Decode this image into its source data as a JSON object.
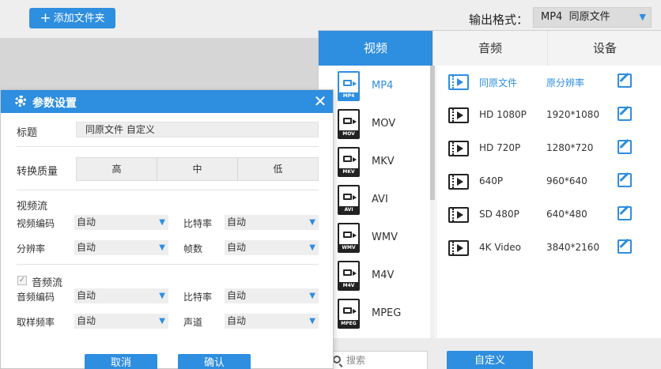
{
  "topbar": {
    "add_folder_label": "添加文件夹",
    "output_format_label": "输出格式：",
    "output_format_value": "MP4  同原文件"
  },
  "format_panel": {
    "tabs": [
      {
        "label": "视频",
        "active": true
      },
      {
        "label": "音频",
        "active": false
      },
      {
        "label": "设备",
        "active": false
      }
    ],
    "formats": [
      {
        "name": "MP4",
        "tag": "MP4",
        "selected": true
      },
      {
        "name": "MOV",
        "tag": "MOV",
        "selected": false
      },
      {
        "name": "MKV",
        "tag": "MKV",
        "selected": false
      },
      {
        "name": "AVI",
        "tag": "AVI",
        "selected": false
      },
      {
        "name": "WMV",
        "tag": "WMV",
        "selected": false
      },
      {
        "name": "M4V",
        "tag": "M4V",
        "selected": false
      },
      {
        "name": "MPEG",
        "tag": "MPEG",
        "selected": false
      }
    ],
    "presets": [
      {
        "name": "同原文件",
        "resolution": "原分辨率",
        "selected": true
      },
      {
        "name": "HD 1080P",
        "resolution": "1920*1080",
        "selected": false
      },
      {
        "name": "HD 720P",
        "resolution": "1280*720",
        "selected": false
      },
      {
        "name": "640P",
        "resolution": "960*640",
        "selected": false
      },
      {
        "name": "SD 480P",
        "resolution": "640*480",
        "selected": false
      },
      {
        "name": "4K Video",
        "resolution": "3840*2160",
        "selected": false
      }
    ],
    "search_placeholder": "搜索",
    "custom_button": "自定义"
  },
  "dialog": {
    "title": "参数设置",
    "close_symbol": "✕",
    "title_label": "标题",
    "title_value": "同原文件 自定义",
    "quality_label": "转换质量",
    "quality_options": [
      "高",
      "中",
      "低"
    ],
    "video_stream_label": "视频流",
    "video_codec_label": "视频编码",
    "video_codec_value": "自动",
    "video_bitrate_label": "比特率",
    "video_bitrate_value": "自动",
    "resolution_label": "分辨率",
    "resolution_value": "自动",
    "framerate_label": "帧数",
    "framerate_value": "自动",
    "audio_stream_label": "音频流",
    "audio_stream_checked": true,
    "audio_codec_label": "音频编码",
    "audio_codec_value": "自动",
    "audio_bitrate_label": "比特率",
    "audio_bitrate_value": "自动",
    "sample_rate_label": "取样频率",
    "sample_rate_value": "自动",
    "channel_label": "声道",
    "channel_value": "自动",
    "cancel_button": "取消",
    "confirm_button": "确认"
  },
  "colors": {
    "accent": "#2e8ee0",
    "background": "#d6d6d6",
    "panel_bg": "#ffffff"
  }
}
